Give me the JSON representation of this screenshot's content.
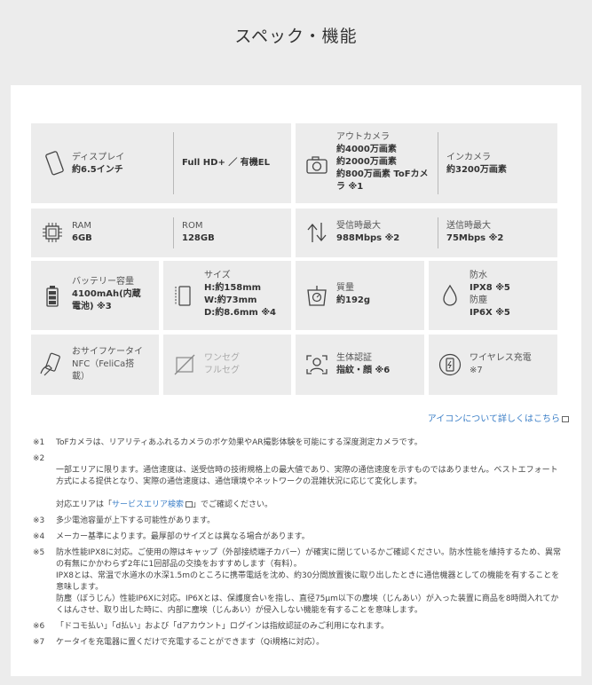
{
  "page_title": "スペック・機能",
  "specs": {
    "display": {
      "label": "ディスプレイ",
      "value": "約6.5インチ",
      "detail": "Full HD+ ／ 有機EL"
    },
    "out_camera": {
      "label": "アウトカメラ",
      "value": "約4000万画素\n約2000万画素\n約800万画素 ToFカメ\nラ ※1"
    },
    "in_camera": {
      "label": "インカメラ",
      "value": "約3200万画素"
    },
    "ram": {
      "label": "RAM",
      "value": "6GB"
    },
    "rom": {
      "label": "ROM",
      "value": "128GB"
    },
    "download": {
      "label": "受信時最大",
      "value": "988Mbps ※2"
    },
    "upload": {
      "label": "送信時最大",
      "value": "75Mbps ※2"
    },
    "battery": {
      "label": "バッテリー容量",
      "value": "4100mAh(内蔵\n電池) ※3"
    },
    "size": {
      "label": "サイズ",
      "value": "H:約158mm\nW:約73mm\nD:約8.6mm ※4"
    },
    "weight": {
      "label": "質量",
      "value": "約192g"
    },
    "water": {
      "label1": "防水",
      "value1": "IPX8 ※5",
      "label2": "防塵",
      "value2": "IP6X ※5"
    },
    "osaifu": {
      "label": "おサイフケータイ\nNFC（FeliCa搭\n載）"
    },
    "oneseg": {
      "label": "ワンセグ\nフルセグ"
    },
    "biometric": {
      "label": "生体認証",
      "value": "指紋・顔 ※6"
    },
    "wireless": {
      "label": "ワイヤレス充電",
      "value": "※7"
    }
  },
  "icon_link": "アイコンについて詳しくはこちら",
  "notes": [
    {
      "num": "※1",
      "text": "ToFカメラは、リアリティあふれるカメラのボケ効果やAR撮影体験を可能にする深度測定カメラです。"
    },
    {
      "num": "※2",
      "text": "一部エリアに限ります。通信速度は、送受信時の技術規格上の最大値であり、実際の通信速度を示すものではありません。ベストエフォート方式による提供となり、実際の通信速度は、通信環境やネットワークの混雑状況に応じて変化します。",
      "pre_link": "対応エリアは「",
      "link": "サービスエリア検索",
      "post_link": "」でご確認ください。"
    },
    {
      "num": "※3",
      "text": "多少電池容量が上下する可能性があります。"
    },
    {
      "num": "※4",
      "text": "メーカー基準によります。最厚部のサイズとは異なる場合があります。"
    },
    {
      "num": "※5",
      "text": "防水性能IPX8に対応。ご使用の際はキャップ（外部接続端子カバー）が確実に閉じているかご確認ください。防水性能を維持するため、異常の有無にかかわらず2年に1回部品の交換をおすすめします（有料）。\nIPX8とは、常温で水道水の水深1.5mのところに携帯電話を沈め、約30分間放置後に取り出したときに通信機器としての機能を有することを意味します。\n防塵（ぼうじん）性能IP6Xに対応。IP6Xとは、保護度合いを指し、直径75μm以下の塵埃（じんあい）が入った装置に商品を8時間入れてかくはんさせ、取り出した時に、内部に塵埃（じんあい）が侵入しない機能を有することを意味します。"
    },
    {
      "num": "※6",
      "text": "「ドコモ払い」「d払い」および「dアカウント」ログインは指紋認証のみご利用になれます。"
    },
    {
      "num": "※7",
      "text": "ケータイを充電器に置くだけで充電することができます（Qi規格に対応）。"
    }
  ]
}
